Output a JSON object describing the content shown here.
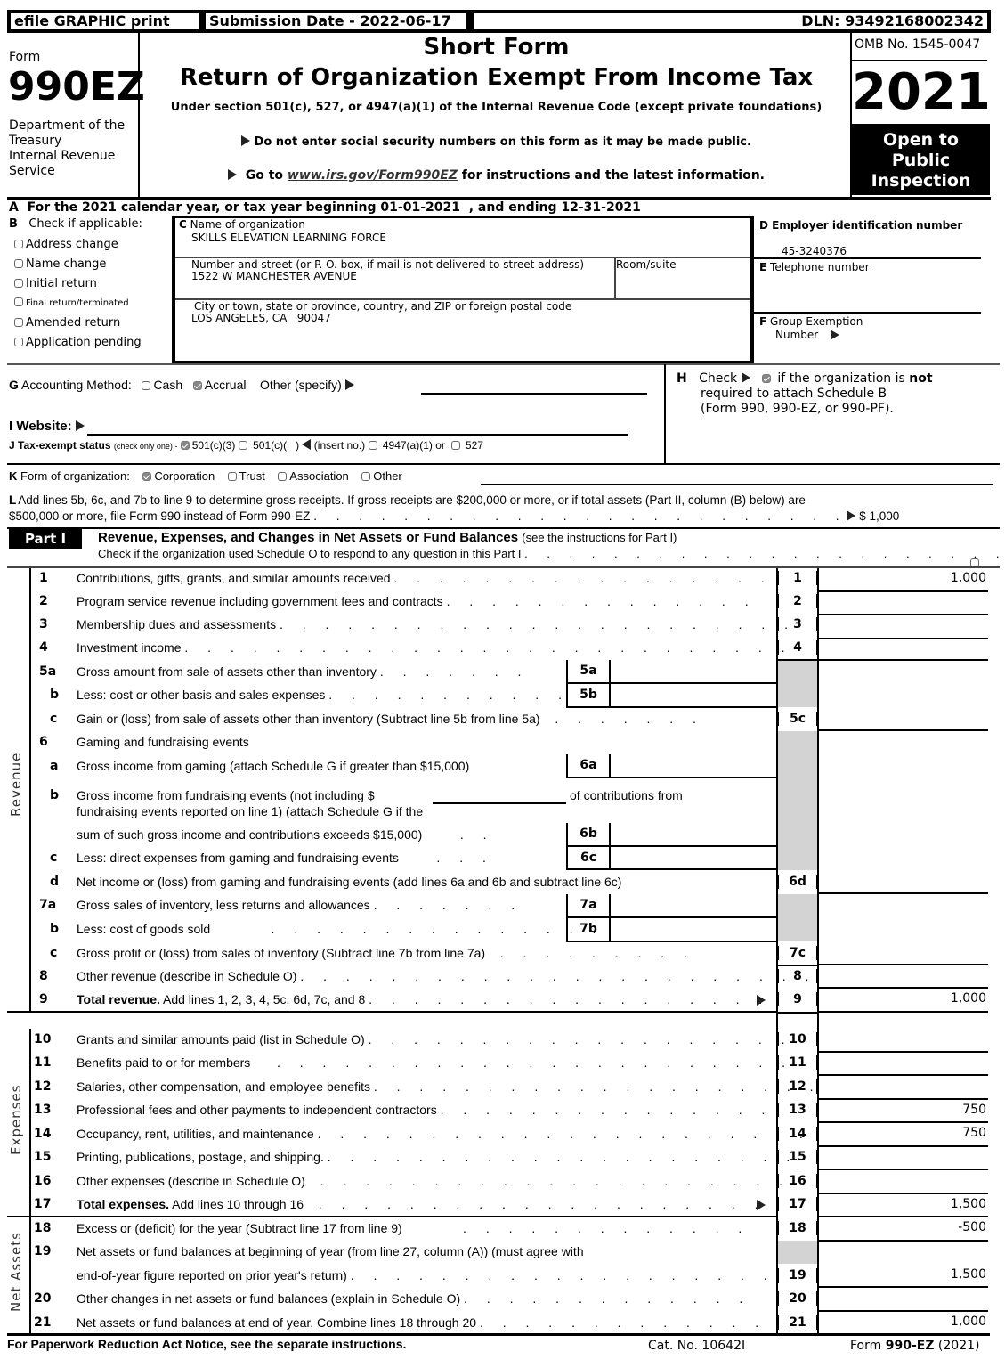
{
  "header": {
    "efile_label": "efile GRAPHIC print",
    "submission_date": "Submission Date - 2022-06-17",
    "dln": "DLN: 93492168002342",
    "form_word": "Form",
    "form_number": "990EZ",
    "department": [
      "Department of the",
      "Treasury",
      "Internal Revenue",
      "Service"
    ],
    "title_line1": "Short Form",
    "title_line2": "Return of Organization Exempt From Income Tax",
    "subtitle": "Under section 501(c), 527, or 4947(a)(1) of the Internal Revenue Code (except private foundations)",
    "notice_ssn": "Do not enter social security numbers on this form as it may be made public.",
    "goto_prefix": "Go to ",
    "goto_link": "www.irs.gov/Form990EZ",
    "goto_suffix": " for instructions and the latest information.",
    "omb": "OMB No. 1545-0047",
    "year": "2021",
    "open_to_public": [
      "Open to",
      "Public",
      "Inspection"
    ]
  },
  "section_a": {
    "text": "A  For the 2021 calendar year, or tax year beginning 01-01-2021  , and ending 12-31-2021"
  },
  "section_b": {
    "label_letter": "B",
    "label": "Check if applicable:",
    "options": [
      {
        "label": "Address change",
        "checked": false
      },
      {
        "label": "Name change",
        "checked": false
      },
      {
        "label": "Initial return",
        "checked": false
      },
      {
        "label": "Final return/terminated",
        "checked": false
      },
      {
        "label": "Amended return",
        "checked": false
      },
      {
        "label": "Application pending",
        "checked": false
      }
    ]
  },
  "section_c": {
    "name_label_letter": "C",
    "name_label": "Name of organization",
    "name_value": "SKILLS ELEVATION LEARNING FORCE",
    "street_label": "Number and street (or P. O. box, if mail is not delivered to street address)",
    "street_value": "1522 W MANCHESTER AVENUE",
    "room_label": "Room/suite",
    "room_value": "",
    "city_label": "City or town, state or province, country, and ZIP or foreign postal code",
    "city_value": "LOS ANGELES, CA   90047"
  },
  "section_d": {
    "label": "D Employer identification number",
    "value": "45-3240376"
  },
  "section_e": {
    "label_letter": "E",
    "label": "Telephone number",
    "value": ""
  },
  "section_f": {
    "label_letter": "F",
    "label": "Group Exemption",
    "label2": "Number",
    "value": ""
  },
  "section_g": {
    "label_letter": "G",
    "label": "Accounting Method:",
    "options": [
      {
        "label": "Cash",
        "checked": false
      },
      {
        "label": "Accrual",
        "checked": true
      }
    ],
    "other_label": "Other (specify)",
    "other_value": ""
  },
  "section_h": {
    "letter": "H",
    "check_word": "Check",
    "checked": true,
    "text1": "if the organization is ",
    "text_bold": "not",
    "text2": "required to attach Schedule B",
    "text3": "(Form 990, 990-EZ, or 990-PF)."
  },
  "section_i": {
    "label": "I Website:",
    "value": ""
  },
  "section_j": {
    "label": "J Tax-exempt status",
    "note": "(check only one) -",
    "options": [
      {
        "label": "501(c)(3)",
        "checked": true
      },
      {
        "label": "501(c)(   )",
        "checked": false
      },
      {
        "label": "4947(a)(1) or",
        "checked": false
      },
      {
        "label": "527",
        "checked": false
      }
    ],
    "insert_no": "(insert no.)"
  },
  "section_k": {
    "label_letter": "K",
    "label": "Form of organization:",
    "options": [
      {
        "label": "Corporation",
        "checked": true
      },
      {
        "label": "Trust",
        "checked": false
      },
      {
        "label": "Association",
        "checked": false
      },
      {
        "label": "Other",
        "checked": false
      }
    ],
    "other_value": ""
  },
  "section_l": {
    "line1": "L Add lines 5b, 6c, and 7b to line 9 to determine gross receipts. If gross receipts are $200,000 or more, or if total assets (Part II, column (B) below) are",
    "line2": "$500,000 or more, file Form 990 instead of Form 990-EZ",
    "amount": "$ 1,000"
  },
  "part1": {
    "badge": "Part I",
    "title": "Revenue, Expenses, and Changes in Net Assets or Fund Balances",
    "title_note": "(see the instructions for Part I)",
    "schedule_o_text": "Check if the organization used Schedule O to respond to any question in this Part I",
    "schedule_o_checked": false,
    "side_labels": {
      "revenue": "Revenue",
      "expenses": "Expenses",
      "net_assets": "Net Assets"
    },
    "lines": {
      "l1": {
        "num": "1",
        "label": "Contributions, gifts, grants, and similar amounts received",
        "box": "1",
        "value": "1,000"
      },
      "l2": {
        "num": "2",
        "label": "Program service revenue including government fees and contracts",
        "box": "2",
        "value": ""
      },
      "l3": {
        "num": "3",
        "label": "Membership dues and assessments",
        "box": "3",
        "value": ""
      },
      "l4": {
        "num": "4",
        "label": "Investment income",
        "box": "4",
        "value": ""
      },
      "l5a": {
        "num": "5a",
        "label": "Gross amount from sale of assets other than inventory",
        "box": "5a",
        "value": ""
      },
      "l5b": {
        "num": "b",
        "label": "Less: cost or other basis and sales expenses",
        "box": "5b",
        "value": ""
      },
      "l5c": {
        "num": "c",
        "label": "Gain or (loss) from sale of assets other than inventory (Subtract line 5b from line 5a)",
        "box": "5c",
        "value": ""
      },
      "l6": {
        "num": "6",
        "label": "Gaming and fundraising events"
      },
      "l6a": {
        "num": "a",
        "label": "Gross income from gaming (attach Schedule G if greater than $15,000)",
        "box": "6a",
        "value": ""
      },
      "l6b": {
        "num": "b",
        "label_part1": "Gross income from fundraising events (not including $",
        "label_part2": "of contributions from",
        "label_line2": "fundraising events reported on line 1) (attach Schedule G if the",
        "label_line3": "sum of such gross income and contributions exceeds $15,000)",
        "box": "6b",
        "value": "",
        "contributions_value": ""
      },
      "l6c": {
        "num": "c",
        "label": "Less: direct expenses from gaming and fundraising events",
        "box": "6c",
        "value": ""
      },
      "l6d": {
        "num": "d",
        "label": "Net income or (loss) from gaming and fundraising events (add lines 6a and 6b and subtract line 6c)",
        "box": "6d",
        "value": ""
      },
      "l7a": {
        "num": "7a",
        "label": "Gross sales of inventory, less returns and allowances",
        "box": "7a",
        "value": ""
      },
      "l7b": {
        "num": "b",
        "label": "Less: cost of goods sold",
        "box": "7b",
        "value": ""
      },
      "l7c": {
        "num": "c",
        "label": "Gross profit or (loss) from sales of inventory (Subtract line 7b from line 7a)",
        "box": "7c",
        "value": ""
      },
      "l8": {
        "num": "8",
        "label": "Other revenue (describe in Schedule O)",
        "box": "8",
        "value": ""
      },
      "l9": {
        "num": "9",
        "label_bold": "Total revenue.",
        "label": " Add lines 1, 2, 3, 4, 5c, 6d, 7c, and 8",
        "box": "9",
        "value": "1,000"
      },
      "l10": {
        "num": "10",
        "label": "Grants and similar amounts paid (list in Schedule O)",
        "box": "10",
        "value": ""
      },
      "l11": {
        "num": "11",
        "label": "Benefits paid to or for members",
        "box": "11",
        "value": ""
      },
      "l12": {
        "num": "12",
        "label": "Salaries, other compensation, and employee benefits",
        "box": "12",
        "value": ""
      },
      "l13": {
        "num": "13",
        "label": "Professional fees and other payments to independent contractors",
        "box": "13",
        "value": "750"
      },
      "l14": {
        "num": "14",
        "label": "Occupancy, rent, utilities, and maintenance",
        "box": "14",
        "value": "750"
      },
      "l15": {
        "num": "15",
        "label": "Printing, publications, postage, and shipping.",
        "box": "15",
        "value": ""
      },
      "l16": {
        "num": "16",
        "label": "Other expenses (describe in Schedule O)",
        "box": "16",
        "value": ""
      },
      "l17": {
        "num": "17",
        "label_bold": "Total expenses.",
        "label": " Add lines 10 through 16",
        "box": "17",
        "value": "1,500"
      },
      "l18": {
        "num": "18",
        "label": "Excess or (deficit) for the year (Subtract line 17 from line 9)",
        "box": "18",
        "value": "-500"
      },
      "l19": {
        "num": "19",
        "label": "Net assets or fund balances at beginning of year (from line 27, column (A)) (must agree with",
        "label_line2": "end-of-year figure reported on prior year's return)",
        "box": "19",
        "value": "1,500"
      },
      "l20": {
        "num": "20",
        "label": "Other changes in net assets or fund balances (explain in Schedule O)",
        "box": "20",
        "value": ""
      },
      "l21": {
        "num": "21",
        "label": "Net assets or fund balances at end of year. Combine lines 18 through 20",
        "box": "21",
        "value": "1,000"
      }
    }
  },
  "footer": {
    "paperwork": "For Paperwork Reduction Act Notice, see the separate instructions.",
    "cat_no": "Cat. No. 10642I",
    "form_prefix": "Form ",
    "form_bold": "990-EZ",
    "form_suffix": " (2021)"
  }
}
